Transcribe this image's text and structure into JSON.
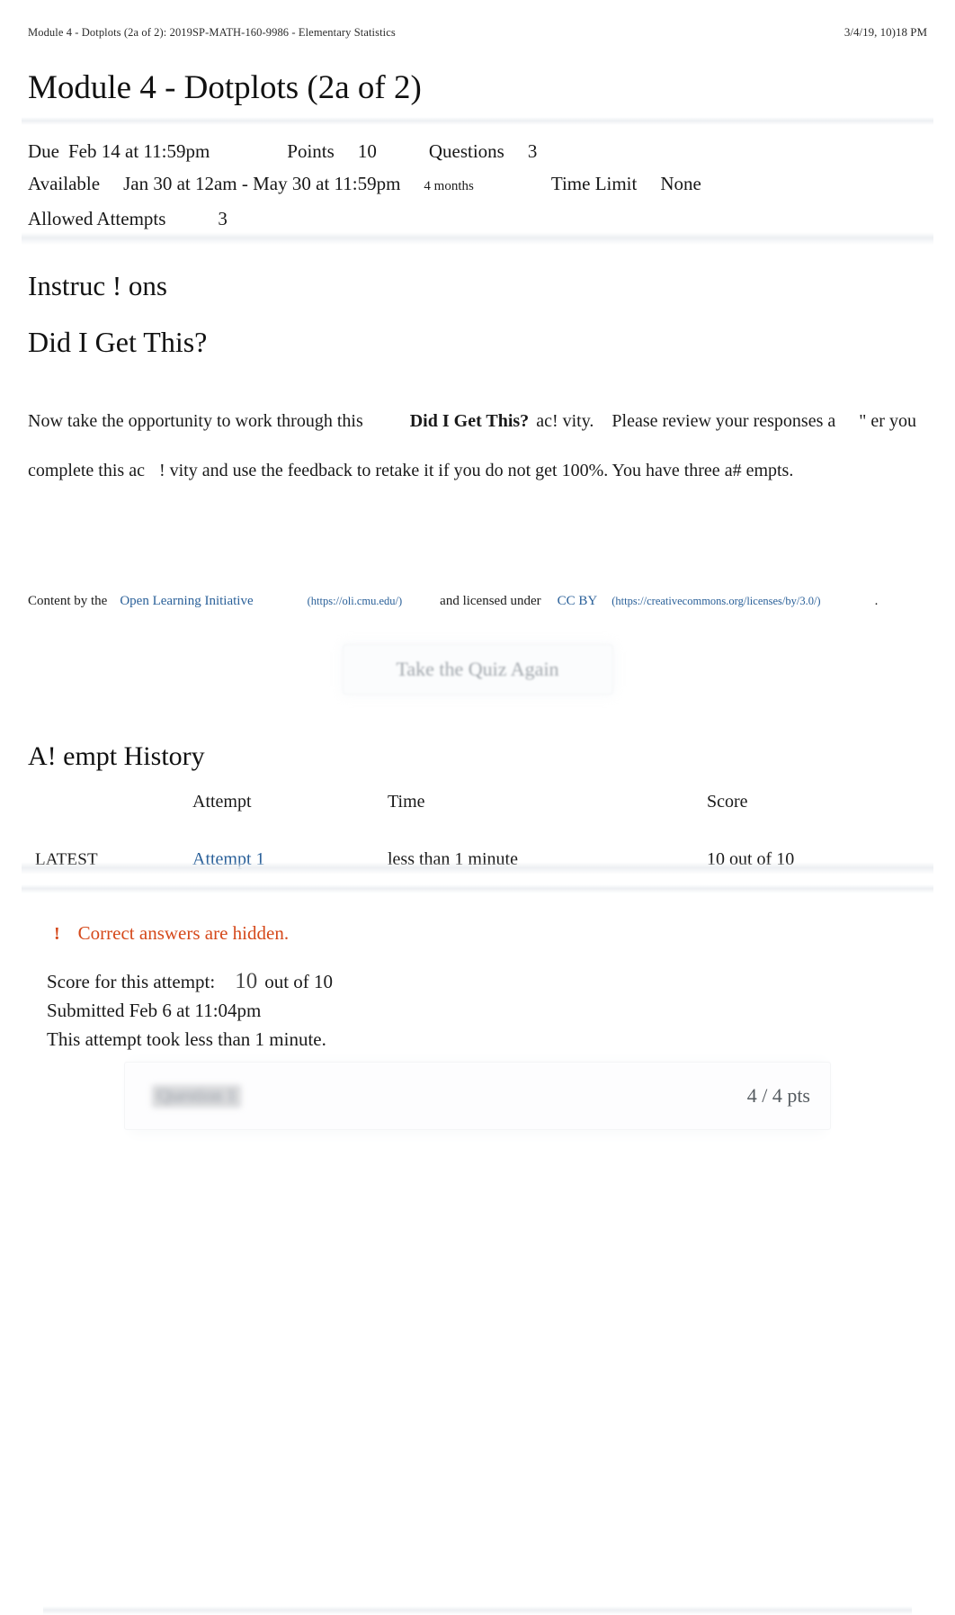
{
  "print_header": {
    "title": "Module 4 - Dotplots (2a of 2): 2019SP-MATH-160-9986 - Elementary Statistics",
    "timestamp": "3/4/19, 10)18 PM"
  },
  "page_title": "Module 4 - Dotplots (2a of 2)",
  "meta": {
    "due_label": "Due",
    "due_value": "Feb 14 at 11:59pm",
    "points_label": "Points",
    "points_value": "10",
    "questions_label": "Questions",
    "questions_value": "3",
    "available_label": "Available",
    "available_value": "Jan 30 at 12am - May 30 at 11:59pm",
    "duration": "4 months",
    "time_limit_label": "Time Limit",
    "time_limit_value": "None",
    "allowed_attempts_label": "Allowed Attempts",
    "allowed_attempts_value": "3"
  },
  "instructions": {
    "heading": "Instruc ! ons",
    "subheading": "Did I Get This?",
    "para_1a": "Now take the opportunity to work through this",
    "para_bold": "Did I Get This?",
    "para_1b": "ac! vity.",
    "para_1c": "Please review your responses a",
    "para_1d": "\" er",
    "para_2a": "you complete this ac",
    "para_2b": "! vity and use the feedback to retake it if you do not get 100%. You have three",
    "para_3": "a# empts."
  },
  "attribution": {
    "prefix": "Content by the",
    "link1_text": "Open Learning Initiative",
    "link1_url": "(https://oli.cmu.edu/)",
    "middle": "and licensed under",
    "link2_text": "CC BY",
    "link2_url": "(https://creativecommons.org/licenses/by/3.0/)",
    "suffix": "."
  },
  "take_quiz_again_button": "Take the Quiz Again",
  "attempt_history": {
    "heading": "A! empt History",
    "columns": [
      "",
      "Attempt",
      "Time",
      "Score"
    ],
    "rows": [
      {
        "latest": "LATEST",
        "attempt": "Attempt 1",
        "time": "less than 1 minute",
        "score": "10 out of 10"
      }
    ]
  },
  "warning": {
    "icon": "!",
    "text": "Correct answers are hidden."
  },
  "score_summary": {
    "score_label": "Score for this attempt:",
    "score_value": "10",
    "score_out_of": "out of 10",
    "submitted": "Submitted Feb 6 at 11:04pm",
    "duration": "This attempt took less than 1 minute."
  },
  "question": {
    "label": "Question 1",
    "points": "4 / 4 pts"
  },
  "colors": {
    "link": "#2a6099",
    "warning": "#d5491b",
    "text": "#1a1a1a",
    "muted": "#9aa0a6"
  }
}
